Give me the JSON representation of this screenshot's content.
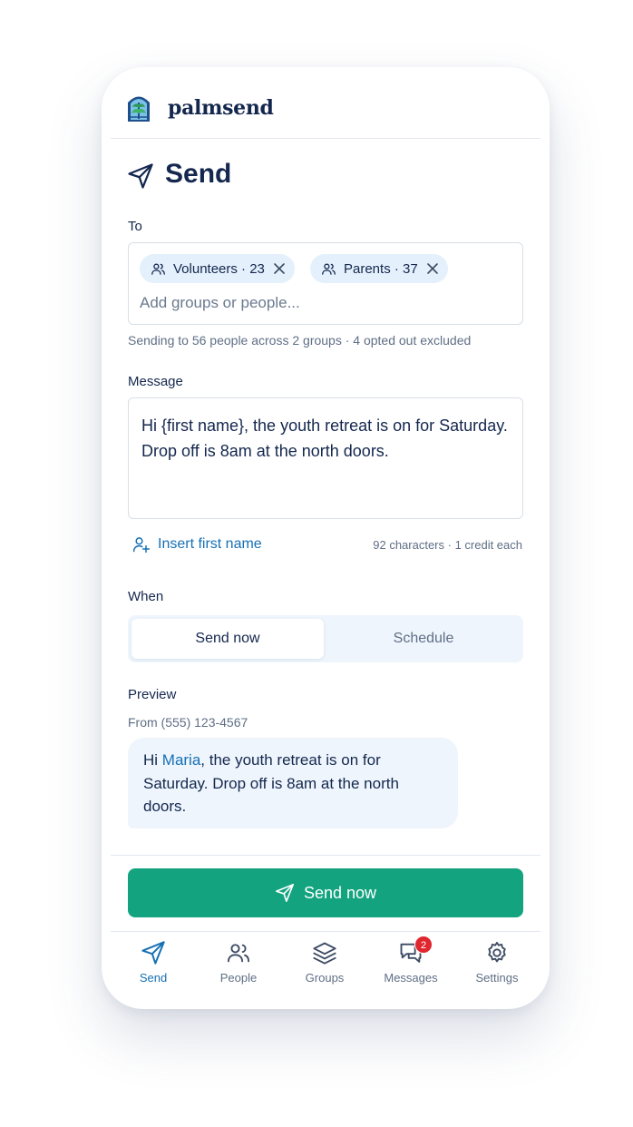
{
  "app": {
    "name": "palmsend"
  },
  "page": {
    "title": "Send"
  },
  "to": {
    "label": "To",
    "recipients": [
      {
        "text": "Volunteers · 23"
      },
      {
        "text": "Parents · 37"
      }
    ],
    "placeholder": "Add groups or people...",
    "summary": "Sending to 56 people across 2 groups · 4 opted out excluded"
  },
  "message": {
    "label": "Message",
    "body": "Hi {first name}, the youth retreat is on for Saturday. Drop off is 8am at the north doors.",
    "insert_label": "Insert first name",
    "counter": "92 characters · 1 credit each"
  },
  "when": {
    "label": "When",
    "options": [
      "Send now",
      "Schedule"
    ],
    "selected": "Send now"
  },
  "preview": {
    "label": "Preview",
    "from": "From (555) 123-4567",
    "greeting": "Hi ",
    "name": "Maria",
    "rest": ", the youth retreat is on for Saturday. Drop off is 8am at the north doors."
  },
  "action": {
    "send_label": "Send now"
  },
  "nav": {
    "items": [
      {
        "label": "Send",
        "icon": "send-icon",
        "active": true
      },
      {
        "label": "People",
        "icon": "people-icon",
        "active": false
      },
      {
        "label": "Groups",
        "icon": "layers-icon",
        "active": false
      },
      {
        "label": "Messages",
        "icon": "chat-icon",
        "active": false,
        "badge": "2"
      },
      {
        "label": "Settings",
        "icon": "gear-icon",
        "active": false
      }
    ]
  },
  "colors": {
    "primary_text": "#14274e",
    "accent_blue": "#1670b4",
    "send_green": "#13a37f",
    "chip_bg": "#e4f0fb",
    "badge_red": "#e0262f"
  }
}
